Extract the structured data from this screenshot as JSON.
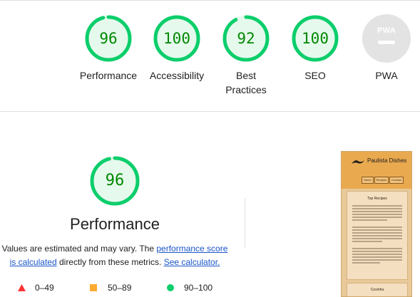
{
  "categories": [
    {
      "id": "performance",
      "score": "96",
      "label_lines": [
        "Performance"
      ],
      "fraction": 0.96
    },
    {
      "id": "accessibility",
      "score": "100",
      "label_lines": [
        "Accessibility"
      ],
      "fraction": 1.0
    },
    {
      "id": "best-practices",
      "score": "92",
      "label_lines": [
        "Best",
        "Practices"
      ],
      "fraction": 0.92
    },
    {
      "id": "seo",
      "score": "100",
      "label_lines": [
        "SEO"
      ],
      "fraction": 1.0
    }
  ],
  "pwa": {
    "badge_text": "PWA",
    "label": "PWA"
  },
  "performance_section": {
    "score": "96",
    "fraction": 0.96,
    "title": "Performance",
    "desc_prefix": "Values are estimated and may vary. The ",
    "link_score": "performance score is calculated",
    "desc_middle": " directly from these metrics. ",
    "link_calc": "See calculator."
  },
  "legend": [
    {
      "range": "0–49",
      "color": "#ff3333",
      "shape": "triangle"
    },
    {
      "range": "50–89",
      "color": "#ffaa33",
      "shape": "square"
    },
    {
      "range": "90–100",
      "color": "#0cce6b",
      "shape": "circle"
    }
  ],
  "thumbnail": {
    "site_title": "Paulista Dishes",
    "nav": [
      "Home",
      "Recipes",
      "Contact"
    ],
    "card_title": "Top Recipes",
    "card2_title": "Coxinha"
  },
  "colors": {
    "pass_ring": "#0cce6b",
    "pass_ring_bg": "#e6f9ed",
    "pass_text": "#008800",
    "link": "#1a56c8"
  }
}
